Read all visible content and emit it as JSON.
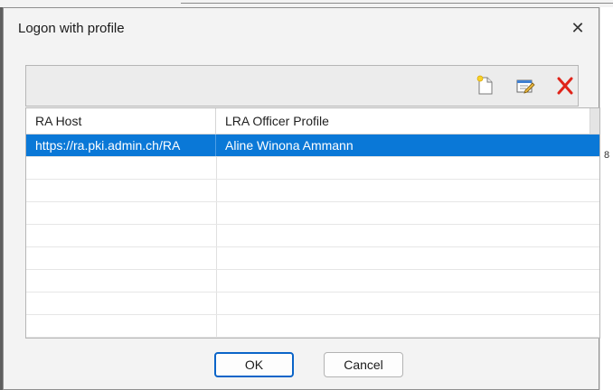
{
  "dialog": {
    "title": "Logon with profile",
    "close_icon": "close-icon",
    "close_glyph": "✕"
  },
  "toolbar": {
    "new_icon": "new-document-icon",
    "edit_icon": "edit-icon",
    "delete_icon": "delete-icon"
  },
  "table": {
    "columns": [
      "RA Host",
      "LRA Officer Profile"
    ],
    "rows": [
      {
        "ra_host": "https://ra.pki.admin.ch/RA",
        "profile": "Aline Winona Ammann",
        "selected": true
      }
    ]
  },
  "buttons": {
    "ok": "OK",
    "cancel": "Cancel"
  },
  "colors": {
    "selection": "#0a78d7",
    "delete_red": "#e0241a",
    "ok_border": "#0a64c8"
  }
}
